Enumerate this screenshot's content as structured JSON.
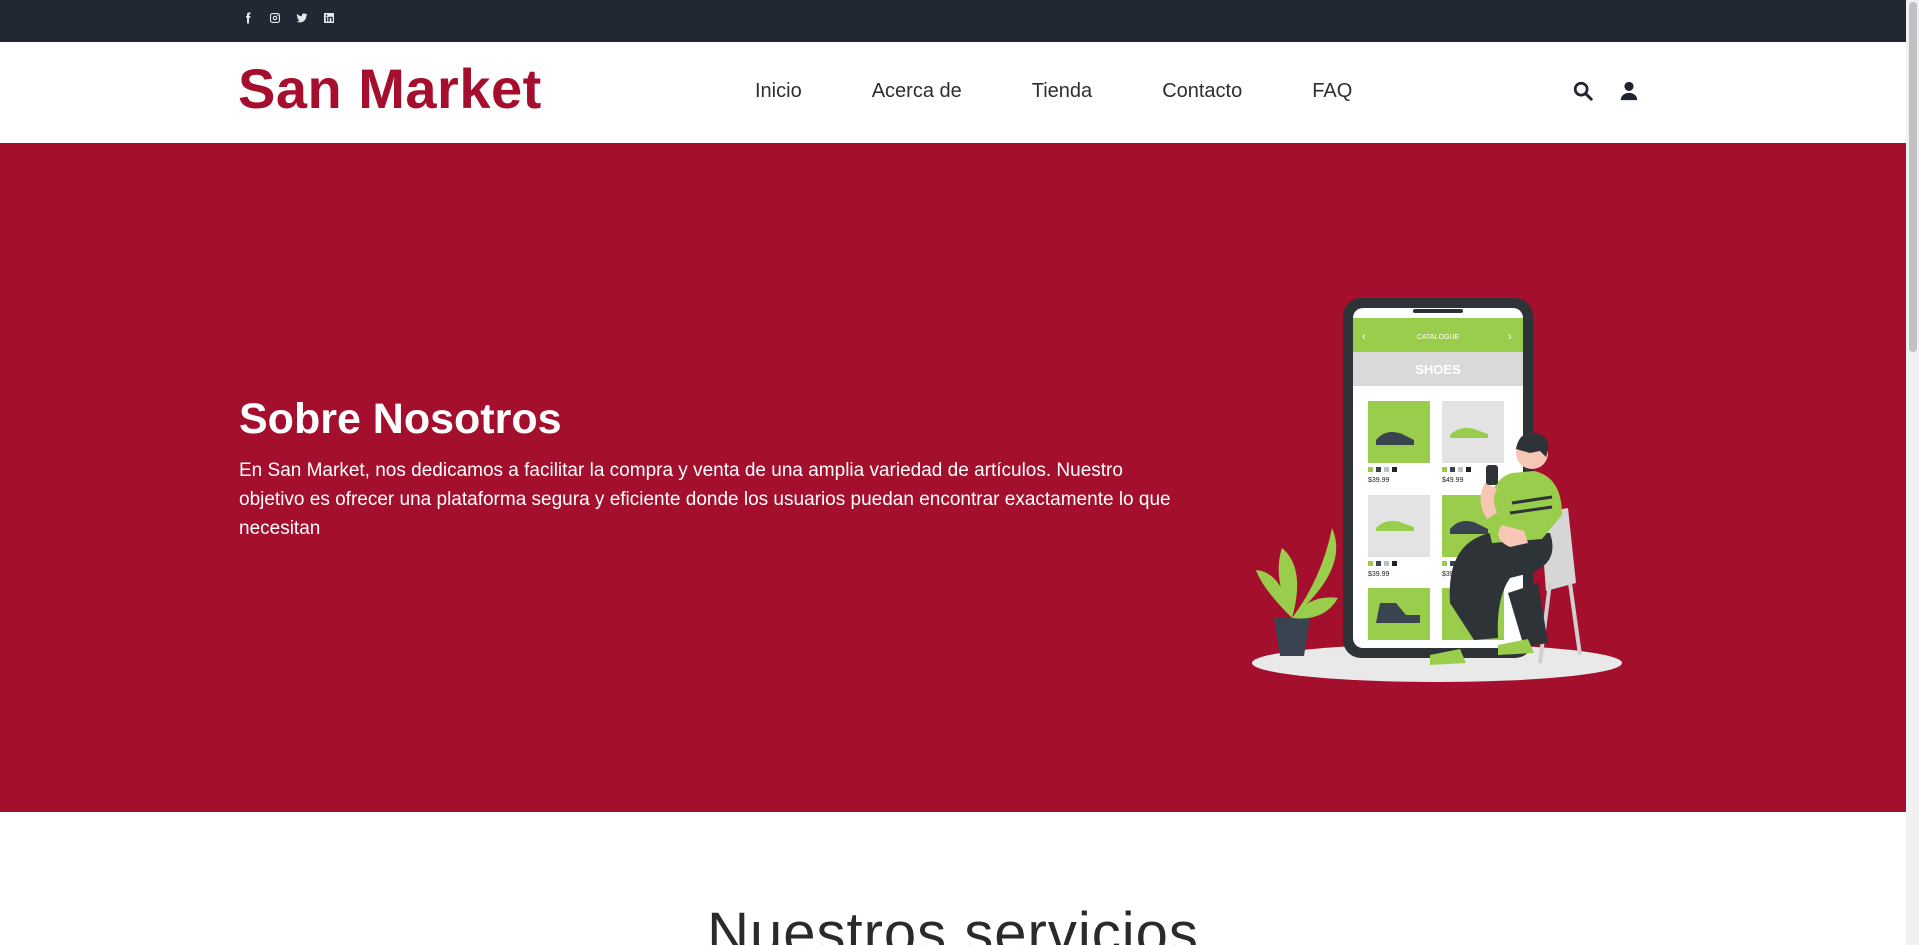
{
  "topbar": {
    "social": [
      {
        "icon": "facebook-icon"
      },
      {
        "icon": "instagram-icon"
      },
      {
        "icon": "twitter-icon"
      },
      {
        "icon": "linkedin-icon"
      }
    ]
  },
  "header": {
    "brand": "San Market",
    "nav": [
      "Inicio",
      "Acerca de",
      "Tienda",
      "Contacto",
      "FAQ"
    ],
    "icons": [
      "search-icon",
      "user-icon"
    ]
  },
  "hero": {
    "title": "Sobre Nosotros",
    "text": "En San Market, nos dedicamos a facilitar la compra y venta de una amplia variedad de artículos. Nuestro objetivo es ofrecer una plataforma segura y eficiente donde los usuarios puedan encontrar exactamente lo que necesitan",
    "illustration": {
      "catalogue_label": "CATALOGUE",
      "category": "SHOES",
      "prices": [
        "$39.99",
        "$49.99",
        "$39.99",
        "$39.99"
      ]
    }
  },
  "services": {
    "title": "Nuestros servicios"
  },
  "colors": {
    "brand": "#a50e2c",
    "hero_bg": "#a30f2c",
    "topbar_bg": "#212833",
    "accent_green": "#9acd4c"
  }
}
